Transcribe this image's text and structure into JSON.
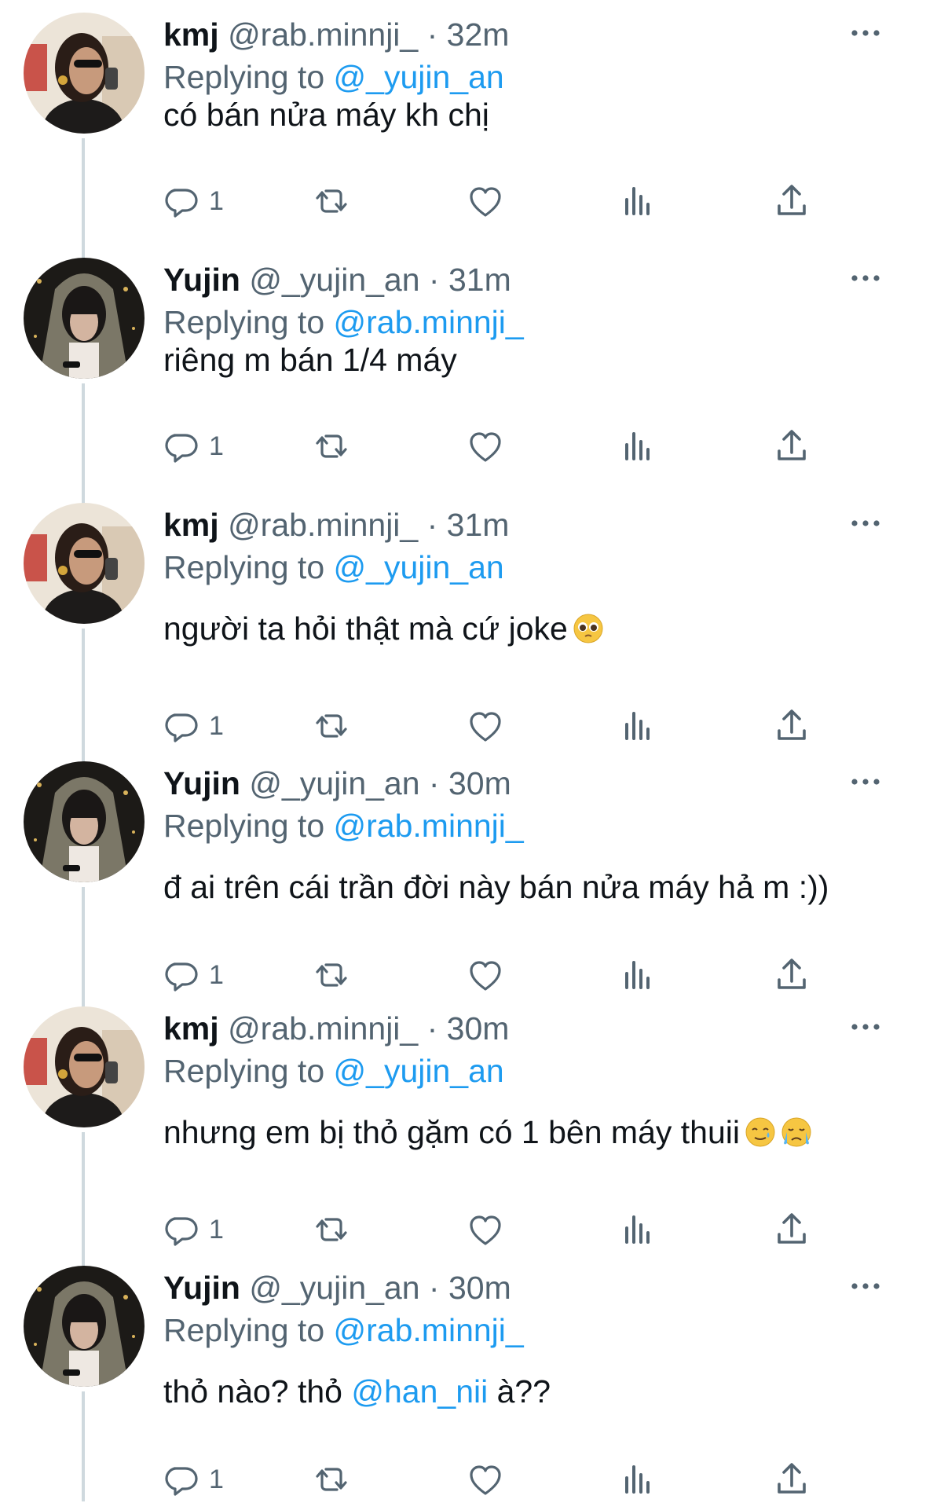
{
  "tweets": [
    {
      "name": "kmj",
      "handle": "@rab.minnji_",
      "time": "32m",
      "replying_prefix": "Replying to",
      "replying_to": "@_yujin_an",
      "text": "có bán nửa máy kh chị",
      "text_mention": "",
      "text_after": "",
      "emojis": [],
      "reply_count": "1",
      "avatar_kind": "kmj"
    },
    {
      "name": "Yujin",
      "handle": "@_yujin_an",
      "time": "31m",
      "replying_prefix": "Replying to",
      "replying_to": "@rab.minnji_",
      "text": "riêng m bán 1/4 máy",
      "text_mention": "",
      "text_after": "",
      "emojis": [],
      "reply_count": "1",
      "avatar_kind": "yujin"
    },
    {
      "name": "kmj",
      "handle": "@rab.minnji_",
      "time": "31m",
      "replying_prefix": "Replying to",
      "replying_to": "@_yujin_an",
      "text": "người ta hỏi thật mà cứ joke",
      "text_mention": "",
      "text_after": "",
      "emojis": [
        "pleading-face-emoji"
      ],
      "reply_count": "1",
      "avatar_kind": "kmj"
    },
    {
      "name": "Yujin",
      "handle": "@_yujin_an",
      "time": "30m",
      "replying_prefix": "Replying to",
      "replying_to": "@rab.minnji_",
      "text": "đ ai trên cái trần đời này bán nửa máy hả m :))",
      "text_mention": "",
      "text_after": "",
      "emojis": [],
      "reply_count": "1",
      "avatar_kind": "yujin"
    },
    {
      "name": "kmj",
      "handle": "@rab.minnji_",
      "time": "30m",
      "replying_prefix": "Replying to",
      "replying_to": "@_yujin_an",
      "text": "nhưng em bị thỏ gặm có 1 bên máy thuii",
      "text_mention": "",
      "text_after": "",
      "emojis": [
        "smiling-tear-emoji",
        "crying-face-emoji"
      ],
      "reply_count": "1",
      "avatar_kind": "kmj"
    },
    {
      "name": "Yujin",
      "handle": "@_yujin_an",
      "time": "30m",
      "replying_prefix": "Replying to",
      "replying_to": "@rab.minnji_",
      "text": "thỏ nào? thỏ ",
      "text_mention": "@han_nii",
      "text_after": " à??",
      "emojis": [],
      "reply_count": "1",
      "avatar_kind": "yujin"
    }
  ],
  "icons": {
    "reply": "reply-icon",
    "retweet": "retweet-icon",
    "like": "heart-icon",
    "views": "views-icon",
    "share": "share-icon",
    "more": "more-icon"
  },
  "colors": {
    "text": "#0f1419",
    "secondary": "#536471",
    "mention": "#1d9bf0",
    "thread": "#cfd9de"
  }
}
